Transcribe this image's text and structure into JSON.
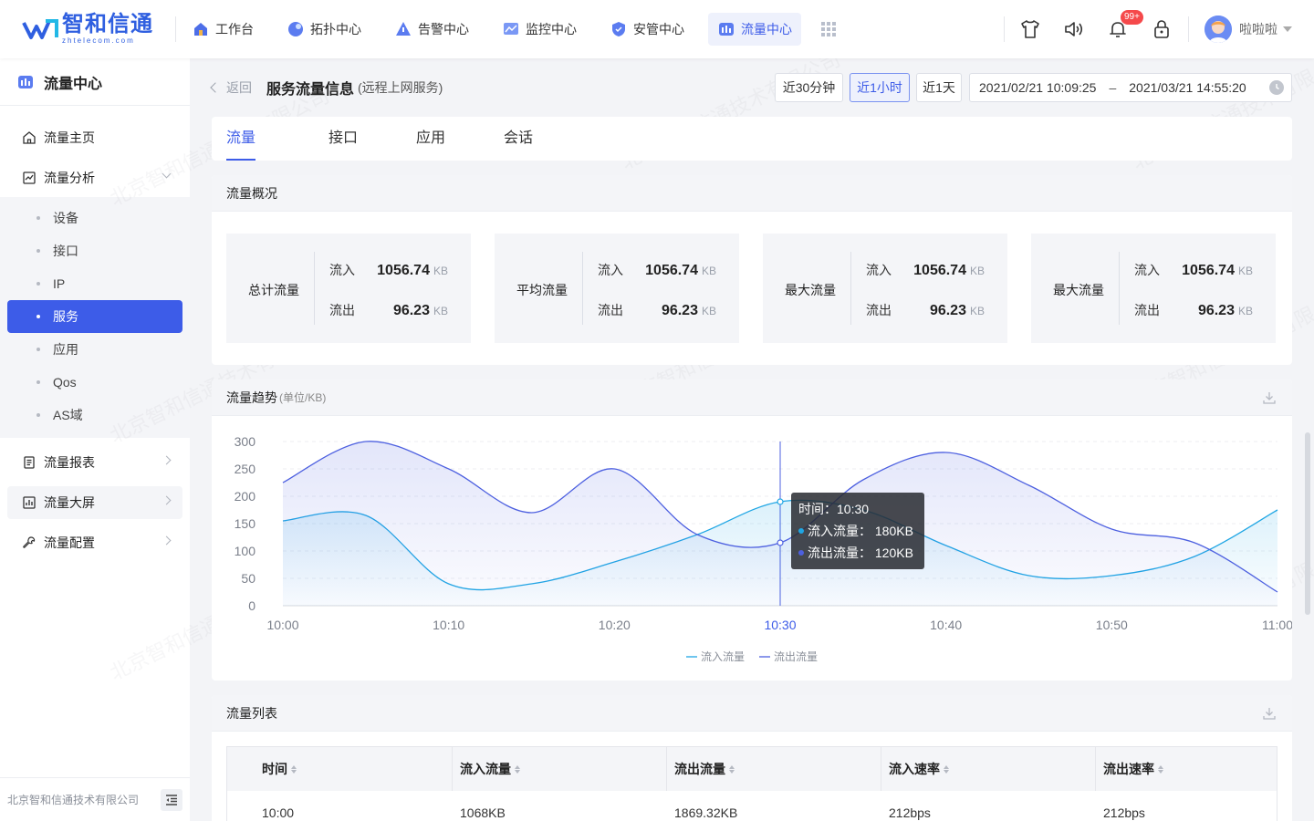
{
  "brand": {
    "name_cn": "智和信通",
    "name_en": "zhtelecom.com",
    "accent": "#3d5ce8"
  },
  "nav": [
    {
      "label": "工作台",
      "icon": "home-icon"
    },
    {
      "label": "拓扑中心",
      "icon": "topology-icon"
    },
    {
      "label": "告警中心",
      "icon": "alarm-icon"
    },
    {
      "label": "监控中心",
      "icon": "monitor-icon"
    },
    {
      "label": "安管中心",
      "icon": "shield-icon"
    },
    {
      "label": "流量中心",
      "icon": "traffic-icon",
      "active": true
    }
  ],
  "header": {
    "notifications_badge": "99+",
    "user_name": "啦啦啦"
  },
  "sidebar": {
    "title": "流量中心",
    "items": {
      "home": "流量主页",
      "analysis": "流量分析",
      "report": "流量报表",
      "bigscreen": "流量大屏",
      "config": "流量配置"
    },
    "sub_items": [
      "设备",
      "接口",
      "IP",
      "服务",
      "应用",
      "Qos",
      "AS域"
    ],
    "active_sub": "服务",
    "footer": "北京智和信通技术有限公司"
  },
  "page": {
    "back": "返回",
    "title": "服务流量信息",
    "subtitle": "(远程上网服务)",
    "time_buttons": [
      "近30分钟",
      "近1小时",
      "近1天"
    ],
    "active_time": "近1小时",
    "range_start": "2021/02/21 10:09:25",
    "range_sep": "–",
    "range_end": "2021/03/21 14:55:20"
  },
  "tabs": [
    "流量",
    "接口",
    "应用",
    "会话"
  ],
  "overview": {
    "title": "流量概况",
    "in_label": "流入",
    "out_label": "流出",
    "unit": "KB",
    "stats": [
      {
        "label": "总计流量",
        "in": "1056.74",
        "out": "96.23"
      },
      {
        "label": "平均流量",
        "in": "1056.74",
        "out": "96.23"
      },
      {
        "label": "最大流量",
        "in": "1056.74",
        "out": "96.23"
      },
      {
        "label": "最大流量",
        "in": "1056.74",
        "out": "96.23"
      }
    ]
  },
  "trend": {
    "title": "流量趋势",
    "unit": "(单位/KB)"
  },
  "tooltip": {
    "time": "时间：10:30",
    "in": "流入流量： 180KB",
    "out": "流出流量： 120KB"
  },
  "chart_data": {
    "type": "area",
    "x": [
      "10:00",
      "10:05",
      "10:10",
      "10:15",
      "10:20",
      "10:25",
      "10:30",
      "10:35",
      "10:40",
      "10:45",
      "10:50",
      "10:55",
      "11:00"
    ],
    "x_ticks": [
      "10:00",
      "10:10",
      "10:20",
      "10:30",
      "10:40",
      "10:50",
      "11:00"
    ],
    "highlight_x": "10:30",
    "ylim": [
      0,
      300
    ],
    "y_ticks": [
      0,
      50,
      100,
      150,
      200,
      250,
      300
    ],
    "grid": true,
    "legend_position": "bottom-center",
    "series": [
      {
        "name": "流入流量",
        "color": "#1fa6e4",
        "values": [
          155,
          165,
          40,
          40,
          80,
          130,
          190,
          175,
          110,
          55,
          55,
          90,
          175
        ]
      },
      {
        "name": "流出流量",
        "color": "#4d60e0",
        "values": [
          225,
          300,
          250,
          170,
          250,
          130,
          115,
          230,
          280,
          220,
          140,
          115,
          25
        ]
      }
    ]
  },
  "list": {
    "title": "流量列表",
    "columns": [
      "时间",
      "流入流量",
      "流出流量",
      "流入速率",
      "流出速率"
    ],
    "rows": [
      [
        "10:00",
        "1068KB",
        "1869.32KB",
        "212bps",
        "212bps"
      ]
    ]
  }
}
